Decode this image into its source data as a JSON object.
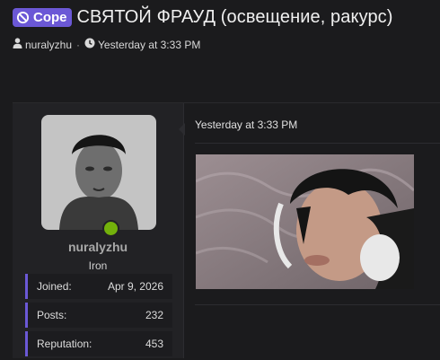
{
  "thread": {
    "prefix_label": "Cope",
    "title": "СВЯТОЙ ФРАУД (освещение, ракурс)",
    "author": "nuralyzhu",
    "separator": "·",
    "date": "Yesterday at 3:33 PM"
  },
  "user": {
    "name": "nuralyzhu",
    "title": "Iron",
    "online": true,
    "stats": [
      {
        "label": "Joined:",
        "value": "Apr 9, 2026"
      },
      {
        "label": "Posts:",
        "value": "232"
      },
      {
        "label": "Reputation:",
        "value": "453"
      }
    ]
  },
  "post": {
    "time": "Yesterday at 3:33 PM"
  },
  "colors": {
    "accent": "#6b58d6",
    "online": "#73b10b",
    "background": "#1b1b1d"
  },
  "icons": {
    "prefix": "ban-icon",
    "author": "user-icon",
    "date": "clock-icon"
  }
}
